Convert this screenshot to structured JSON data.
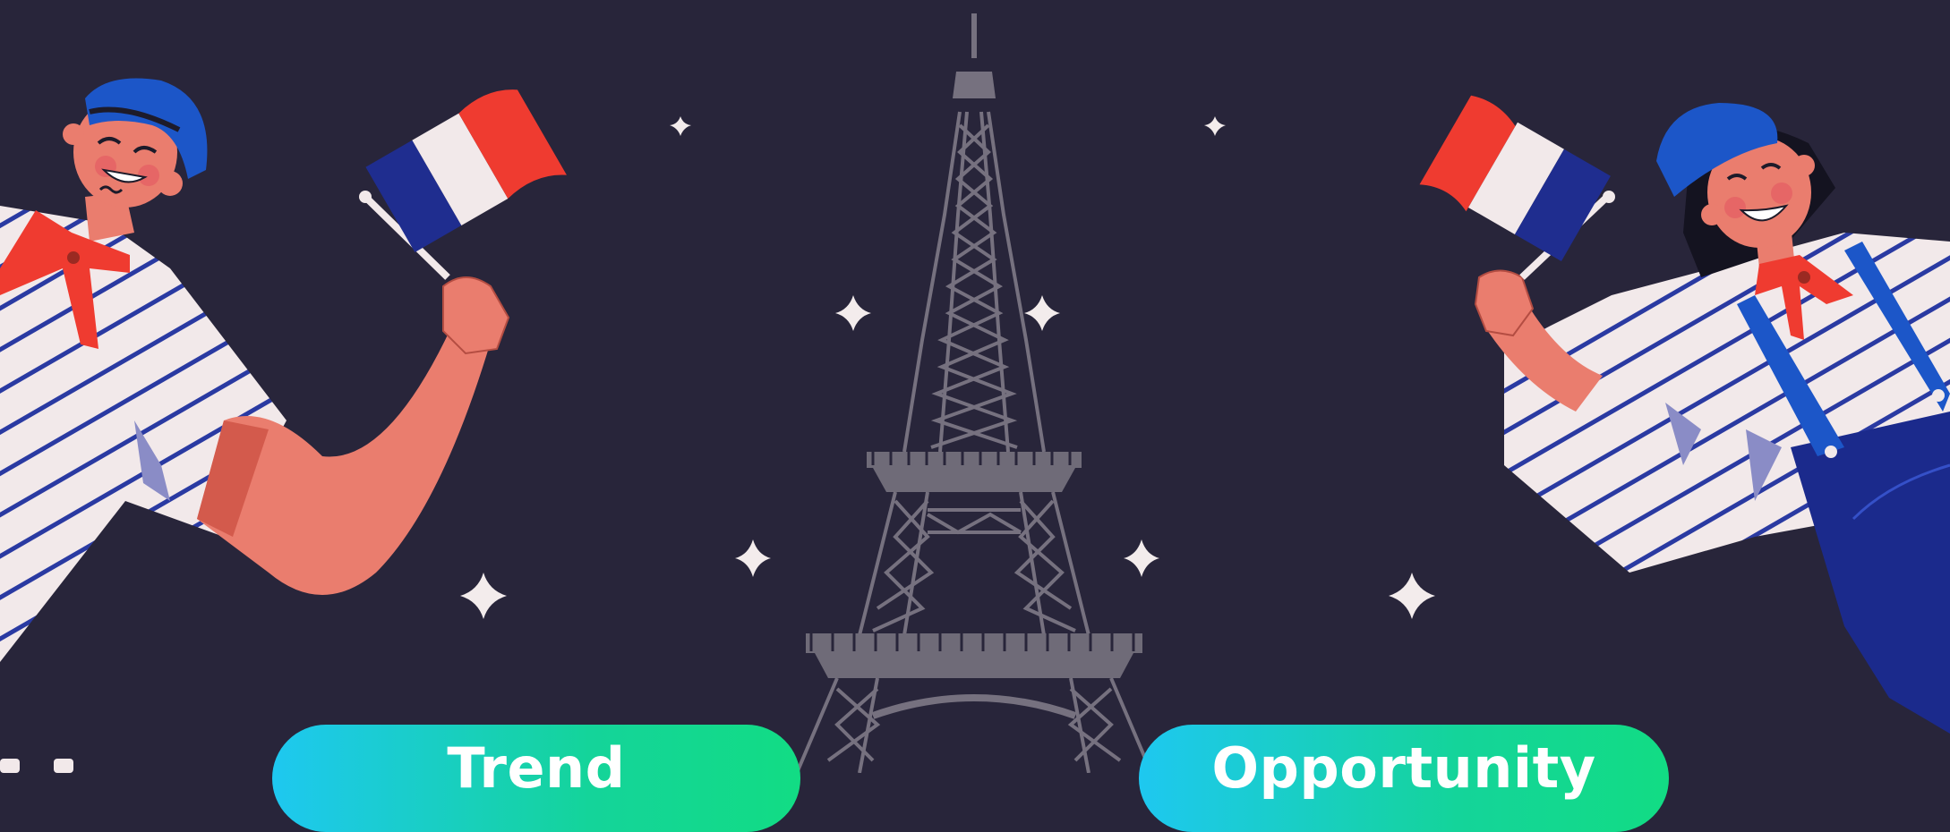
{
  "buttons": {
    "trend_label": "Trend",
    "opportunity_label": "Opportunity"
  },
  "colors": {
    "background": "#28253a",
    "flag_blue": "#1f2d8f",
    "flag_white": "#f2e9ea",
    "flag_red": "#ef3b30",
    "beret_blue": "#1c56c8",
    "skin": "#ea7d6e",
    "tower": "#6f6b78",
    "button_gradient_start": "#1ec8f0",
    "button_gradient_end": "#12dc84"
  },
  "icons": [
    "eiffel-tower-icon",
    "france-flag-icon",
    "sparkle-star-icon",
    "beret-icon"
  ]
}
